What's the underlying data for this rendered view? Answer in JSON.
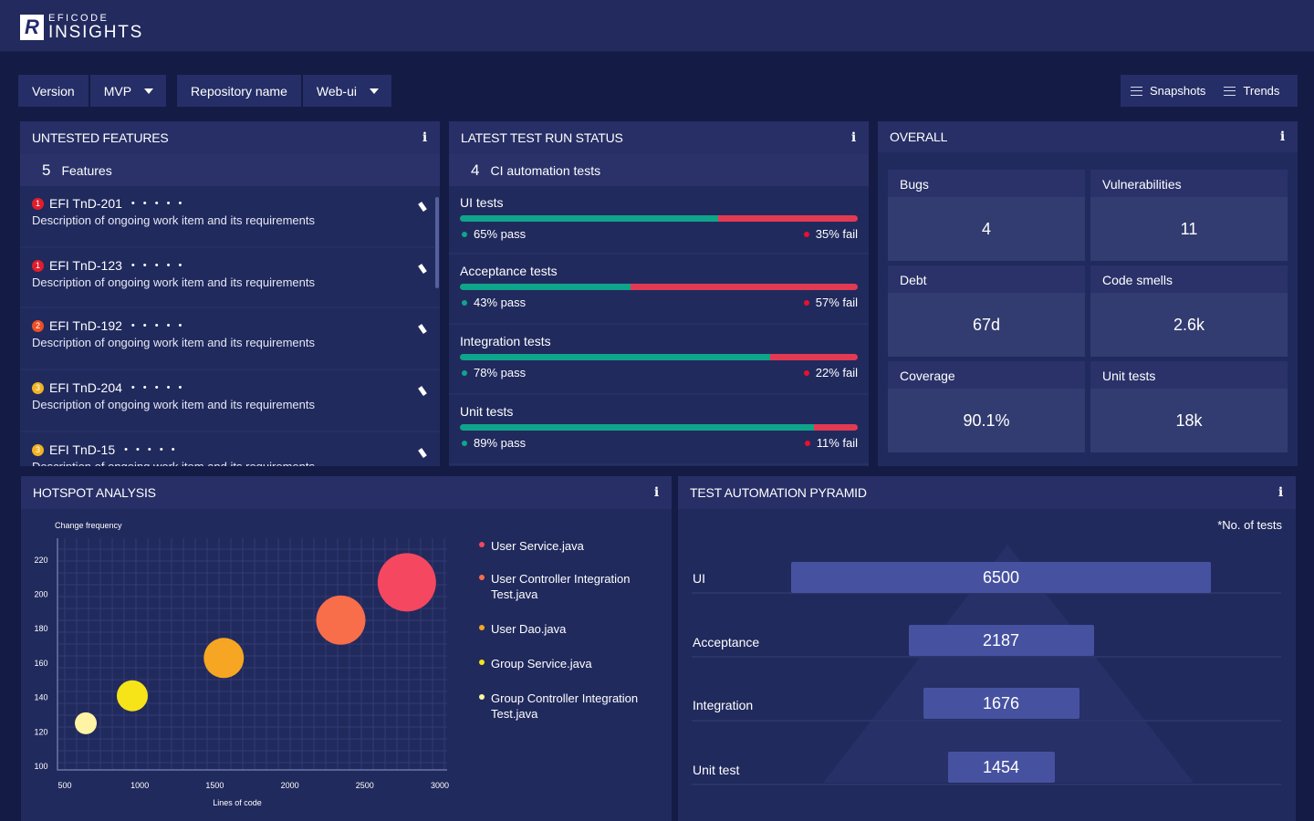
{
  "app": {
    "logo_letter": "R",
    "brand_small": "EFICODE",
    "brand_big": "INSIGHTS"
  },
  "filters": [
    {
      "label": "Version",
      "value": "MVP"
    },
    {
      "label": "Repository name",
      "value": "Web-ui"
    }
  ],
  "toolbar": {
    "snapshots_label": "Snapshots",
    "trends_label": "Trends"
  },
  "untested": {
    "title": "UNTESTED FEATURES",
    "count": "5",
    "count_label": "Features",
    "items": [
      {
        "priority": "1",
        "color": "#e11d2c",
        "id": "EFI TnD-201",
        "desc": "Description of ongoing work item and its requirements"
      },
      {
        "priority": "1",
        "color": "#e11d2c",
        "id": "EFI TnD-123",
        "desc": "Description of ongoing work item and its requirements"
      },
      {
        "priority": "2",
        "color": "#ef4f23",
        "id": "EFI TnD-192",
        "desc": "Description of ongoing work item and its requirements"
      },
      {
        "priority": "3",
        "color": "#f0b323",
        "id": "EFI TnD-204",
        "desc": "Description of ongoing work item and its requirements"
      },
      {
        "priority": "3",
        "color": "#f0b323",
        "id": "EFI TnD-15",
        "desc": "Description of ongoing work item and its requirements"
      }
    ],
    "dots": "• • • • •"
  },
  "testrun": {
    "title": "LATEST TEST RUN STATUS",
    "count": "4",
    "count_label": "CI automation tests",
    "pass_color": "#0fa58a",
    "fail_color": "#e23a52",
    "tests": [
      {
        "name": "UI tests",
        "pass": 65,
        "fail": 35,
        "pass_label": "65% pass",
        "fail_label": "35% fail"
      },
      {
        "name": "Acceptance tests",
        "pass": 43,
        "fail": 57,
        "pass_label": "43% pass",
        "fail_label": "57% fail"
      },
      {
        "name": "Integration tests",
        "pass": 78,
        "fail": 22,
        "pass_label": "78% pass",
        "fail_label": "22% fail"
      },
      {
        "name": "Unit tests",
        "pass": 89,
        "fail": 11,
        "pass_label": "89% pass",
        "fail_label": "11% fail"
      }
    ]
  },
  "overall": {
    "title": "OVERALL",
    "tiles": [
      {
        "label": "Bugs",
        "value": "4"
      },
      {
        "label": "Vulnerabilities",
        "value": "11"
      },
      {
        "label": "Debt",
        "value": "67d"
      },
      {
        "label": "Code smells",
        "value": "2.6k"
      },
      {
        "label": "Coverage",
        "value": "90.1%"
      },
      {
        "label": "Unit tests",
        "value": "18k"
      }
    ]
  },
  "hotspot": {
    "title": "HOTSPOT ANALYSIS"
  },
  "chart_data": {
    "type": "scatter",
    "title": "HOTSPOT ANALYSIS",
    "xlabel": "Lines of code",
    "ylabel": "Change frequency",
    "xlim": [
      500,
      3000
    ],
    "ylim": [
      100,
      230
    ],
    "xticks": [
      "500",
      "1000",
      "1500",
      "2000",
      "2500",
      "3000"
    ],
    "yticks": [
      "100",
      "120",
      "140",
      "160",
      "180",
      "200",
      "220"
    ],
    "grid": true,
    "legend_position": "right",
    "series": [
      {
        "name": "User Service.java",
        "x": 2780,
        "y": 207,
        "size": 32,
        "color": "#f5475f"
      },
      {
        "name": "User Controller Integration Test.java",
        "x": 2340,
        "y": 185,
        "size": 27,
        "color": "#f86d4a"
      },
      {
        "name": "User Dao.java",
        "x": 1560,
        "y": 163,
        "size": 22,
        "color": "#f6a623"
      },
      {
        "name": "Group Service.java",
        "x": 950,
        "y": 141,
        "size": 17,
        "color": "#f6e419"
      },
      {
        "name": "Group Controller Integration Test.java",
        "x": 640,
        "y": 125,
        "size": 12,
        "color": "#fff4a3"
      }
    ]
  },
  "pyramid": {
    "title": "TEST AUTOMATION PYRAMID",
    "note": "*No. of  tests",
    "levels": [
      {
        "label": "UI",
        "value": 6500
      },
      {
        "label": "Acceptance",
        "value": 2187
      },
      {
        "label": "Integration",
        "value": 1676
      },
      {
        "label": "Unit test",
        "value": 1454
      }
    ]
  }
}
